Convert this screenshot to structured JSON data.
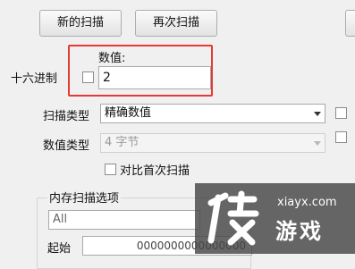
{
  "toolbar": {
    "new_scan_label": "新的扫描",
    "rescan_label": "再次扫描"
  },
  "value_section": {
    "label": "数值:",
    "value": "2",
    "hex_label": "十六进制"
  },
  "scan_type": {
    "label": "扫描类型",
    "selected": "精确数值"
  },
  "value_type": {
    "label": "数值类型",
    "selected": "4 字节"
  },
  "compare_first_scan_label": "对比首次扫描",
  "memory_options": {
    "label": "内存扫描选项",
    "region_selected": "All",
    "start_label": "起始",
    "start_value": "0000000000000000"
  },
  "watermark": {
    "site": "xiayx.com",
    "brand": "游戏"
  },
  "colors": {
    "highlight_border": "#e53935",
    "window_bg": "#f0f0f0"
  }
}
